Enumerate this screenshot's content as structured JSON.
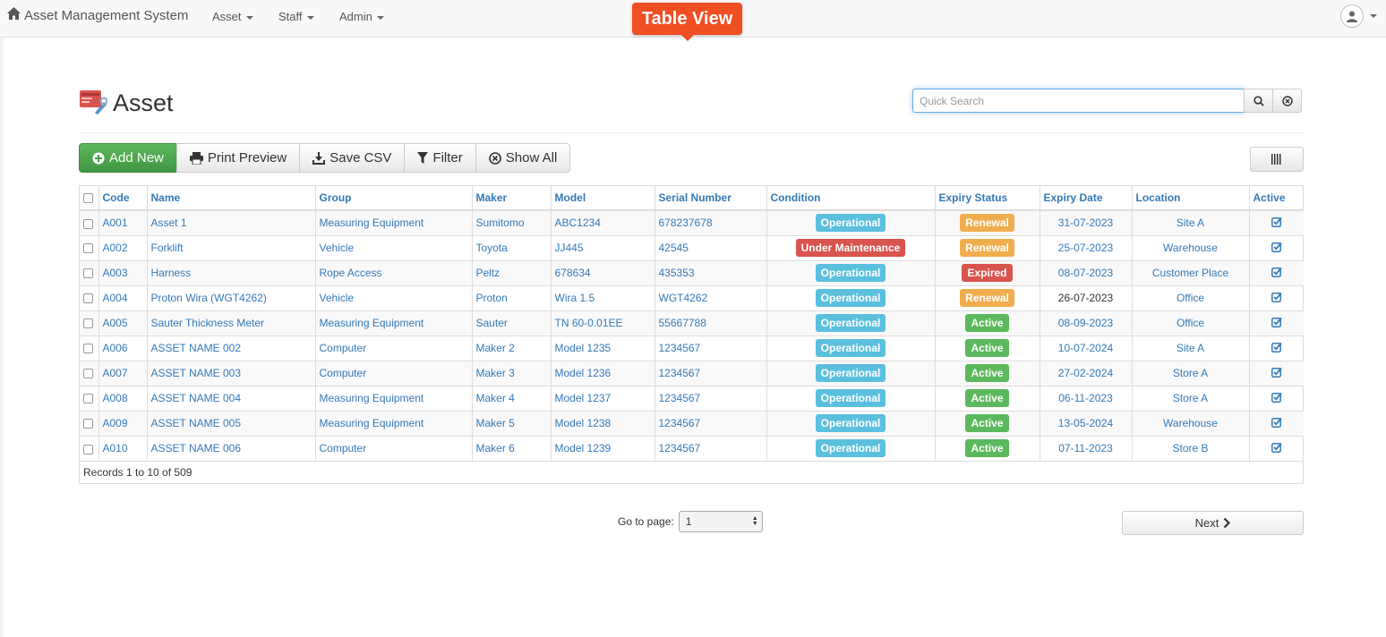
{
  "app": {
    "title": "Asset Management System"
  },
  "nav": {
    "asset": "Asset",
    "staff": "Staff",
    "admin": "Admin"
  },
  "callout": "Table View",
  "page": {
    "title": "Asset"
  },
  "search": {
    "placeholder": "Quick Search"
  },
  "toolbar": {
    "add_new": "Add New",
    "print_preview": "Print Preview",
    "save_csv": "Save CSV",
    "filter": "Filter",
    "show_all": "Show All"
  },
  "table": {
    "columns": [
      "Code",
      "Name",
      "Group",
      "Maker",
      "Model",
      "Serial Number",
      "Condition",
      "Expiry Status",
      "Expiry Date",
      "Location",
      "Active"
    ],
    "rows": [
      {
        "code": "A001",
        "name": "Asset 1",
        "group": "Measuring Equipment",
        "maker": "Sumitomo",
        "model": "ABC1234",
        "serial": "678237678",
        "condition": "Operational",
        "expiry_status": "Renewal",
        "expiry_date": "31-07-2023",
        "location": "Site A"
      },
      {
        "code": "A002",
        "name": "Forklift",
        "group": "Vehicle",
        "maker": "Toyota",
        "model": "JJ445",
        "serial": "42545",
        "condition": "Under Maintenance",
        "expiry_status": "Renewal",
        "expiry_date": "25-07-2023",
        "location": "Warehouse"
      },
      {
        "code": "A003",
        "name": "Harness",
        "group": "Rope Access",
        "maker": "Peltz",
        "model": "678634",
        "serial": "435353",
        "condition": "Operational",
        "expiry_status": "Expired",
        "expiry_date": "08-07-2023",
        "location": "Customer Place"
      },
      {
        "code": "A004",
        "name": "Proton Wira (WGT4262)",
        "group": "Vehicle",
        "maker": "Proton",
        "model": "Wira 1.5",
        "serial": "WGT4262",
        "condition": "Operational",
        "expiry_status": "Renewal",
        "expiry_date": "26-07-2023",
        "location": "Office"
      },
      {
        "code": "A005",
        "name": "Sauter Thickness Meter",
        "group": "Measuring Equipment",
        "maker": "Sauter",
        "model": "TN 60-0.01EE",
        "serial": "55667788",
        "condition": "Operational",
        "expiry_status": "Active",
        "expiry_date": "08-09-2023",
        "location": "Office"
      },
      {
        "code": "A006",
        "name": "ASSET NAME 002",
        "group": "Computer",
        "maker": "Maker 2",
        "model": "Model 1235",
        "serial": "1234567",
        "condition": "Operational",
        "expiry_status": "Active",
        "expiry_date": "10-07-2024",
        "location": "Site A"
      },
      {
        "code": "A007",
        "name": "ASSET NAME 003",
        "group": "Computer",
        "maker": "Maker 3",
        "model": "Model 1236",
        "serial": "1234567",
        "condition": "Operational",
        "expiry_status": "Active",
        "expiry_date": "27-02-2024",
        "location": "Store A"
      },
      {
        "code": "A008",
        "name": "ASSET NAME 004",
        "group": "Measuring Equipment",
        "maker": "Maker 4",
        "model": "Model 1237",
        "serial": "1234567",
        "condition": "Operational",
        "expiry_status": "Active",
        "expiry_date": "06-11-2023",
        "location": "Store A"
      },
      {
        "code": "A009",
        "name": "ASSET NAME 005",
        "group": "Measuring Equipment",
        "maker": "Maker 5",
        "model": "Model 1238",
        "serial": "1234567",
        "condition": "Operational",
        "expiry_status": "Active",
        "expiry_date": "13-05-2024",
        "location": "Warehouse"
      },
      {
        "code": "A010",
        "name": "ASSET NAME 006",
        "group": "Computer",
        "maker": "Maker 6",
        "model": "Model 1239",
        "serial": "1234567",
        "condition": "Operational",
        "expiry_status": "Active",
        "expiry_date": "07-11-2023",
        "location": "Store B"
      }
    ],
    "records": "Records 1 to 10 of 509"
  },
  "badge_colors": {
    "Operational": "#5bc0de",
    "Under Maintenance": "#d9534f",
    "Renewal": "#f0ad4e",
    "Expired": "#d9534f",
    "Active": "#5cb85c"
  },
  "pagination": {
    "goto_label": "Go to page:",
    "current_page": "1",
    "next": "Next"
  },
  "icons": {
    "home": "home-icon",
    "user": "user-icon",
    "asset_logo": "asset-logo-icon",
    "search": "search-icon",
    "clear": "clear-icon",
    "plus": "plus-circle-icon",
    "print": "print-icon",
    "download": "download-icon",
    "filter": "filter-icon",
    "show_all": "times-circle-icon",
    "columns": "columns-icon",
    "active": "check-square-icon",
    "next": "chevron-right-icon"
  }
}
